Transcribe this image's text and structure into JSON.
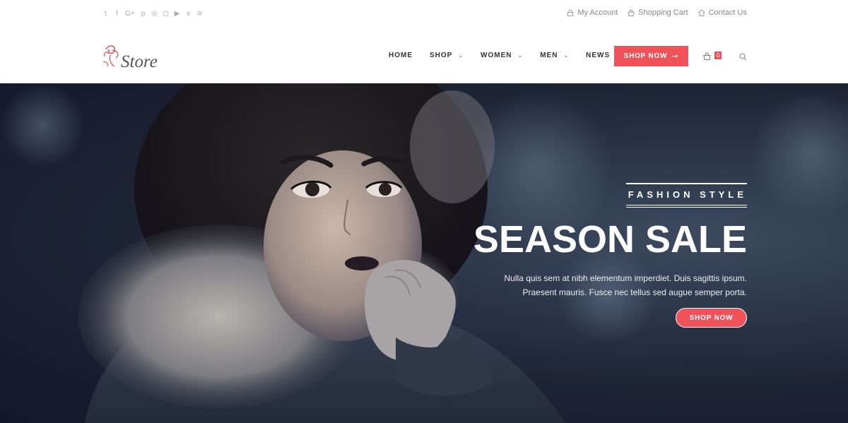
{
  "topbar": {
    "social_icons": [
      "twitter-icon",
      "facebook-icon",
      "google-plus-icon",
      "pinterest-icon",
      "dribbble-icon",
      "instagram-icon",
      "youtube-icon",
      "vimeo-icon",
      "rss-icon"
    ],
    "social_glyphs": [
      "t",
      "f",
      "G+",
      "p",
      "◎",
      "◻",
      "▶",
      "v",
      "≋"
    ],
    "links": [
      {
        "label": "My Account",
        "icon": "lock-icon"
      },
      {
        "label": "Shopping Cart",
        "icon": "shopping-bag-icon"
      },
      {
        "label": "Contact Us",
        "icon": "home-icon"
      }
    ]
  },
  "header": {
    "logo_text": "Store",
    "nav": [
      {
        "label": "HOME",
        "dropdown": false
      },
      {
        "label": "SHOP",
        "dropdown": true
      },
      {
        "label": "WOMEN",
        "dropdown": true
      },
      {
        "label": "MEN",
        "dropdown": true
      },
      {
        "label": "NEWS",
        "dropdown": false
      }
    ],
    "shop_now_label": "SHOP NOW",
    "cart_count": "0"
  },
  "hero": {
    "kicker": "FASHION STYLE",
    "headline": "SEASON SALE",
    "sub_line1": "Nulla quis sem at nibh elementum imperdiet. Duis sagittis ipsum.",
    "sub_line2": "Praesent mauris. Fusce nec tellus sed augue semper porta.",
    "button_label": "SHOP NOW"
  },
  "colors": {
    "accent": "#f0525a",
    "hero_bg": "#1e2535"
  }
}
